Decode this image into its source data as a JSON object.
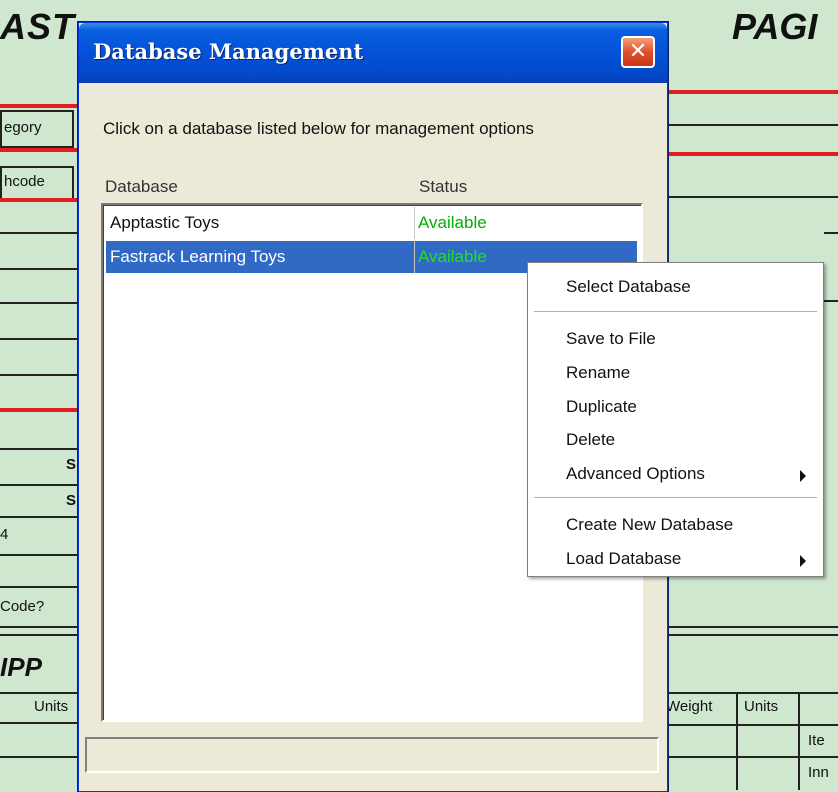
{
  "background": {
    "title_left": "AST",
    "title_right": "PAGI",
    "labels": {
      "category": "egory",
      "matchcode": "hcode",
      "s1": "S",
      "s2": "S",
      "four": "4",
      "code": "Code?",
      "shipping": "IPP",
      "units_left": "Units",
      "weight": "Weight",
      "units_right": "Units",
      "ite": "Ite",
      "inn": "Inn"
    }
  },
  "dialog": {
    "title": "Database Management",
    "close_glyph": "✕",
    "instructions": "Click on a database listed below for management options",
    "columns": [
      "Database",
      "Status"
    ],
    "rows": [
      {
        "name": "Apptastic Toys",
        "status": "Available"
      },
      {
        "name": "Fastrack Learning Toys",
        "status": "Available"
      }
    ],
    "selected_row": 1
  },
  "context_menu": {
    "items": [
      {
        "label": "Select Database"
      },
      {
        "label": "Save to File"
      },
      {
        "label": "Rename"
      },
      {
        "label": "Duplicate"
      },
      {
        "label": "Delete"
      },
      {
        "label": "Advanced Options",
        "submenu": true
      },
      {
        "label": "Create New Database"
      },
      {
        "label": "Load Database",
        "submenu": true
      }
    ]
  },
  "colors": {
    "sheet_bg": "#cfe6cf",
    "titlebar": "#0451d8",
    "selection": "#316ac5",
    "status_available": "#00b000",
    "accent_red": "#e02020"
  }
}
